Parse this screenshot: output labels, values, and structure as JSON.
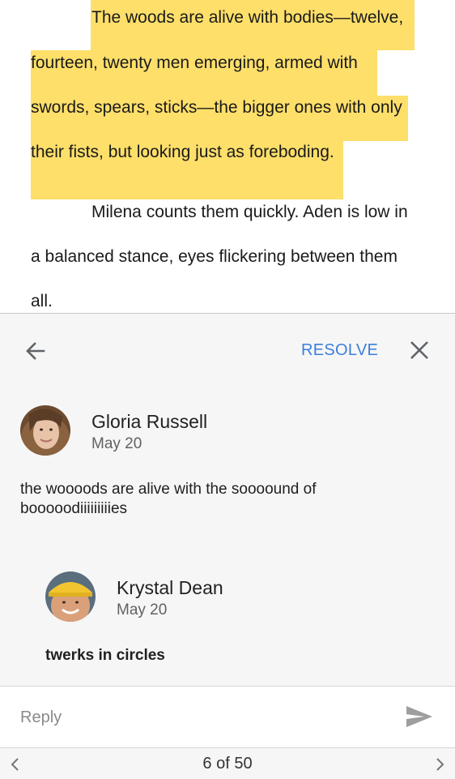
{
  "document": {
    "lines": [
      "The woods are alive with bodies—twelve,",
      "fourteen, twenty men emerging, armed with",
      "swords, spears, sticks—the bigger ones with only",
      "their fists, but looking just as foreboding.",
      "Milena counts them quickly. Aden is low in",
      "a balanced stance, eyes flickering between them",
      "all."
    ],
    "highlight_color": "#fddf6a"
  },
  "comment_panel": {
    "back_icon": "arrow-left-icon",
    "resolve_label": "RESOLVE",
    "close_icon": "close-icon",
    "accent_color": "#3b7fd9",
    "comment": {
      "author": "Gloria Russell",
      "date": "May 20",
      "text": "the woooods are alive with the soooound of booooodiiiiiiiiies"
    },
    "reply": {
      "author": "Krystal Dean",
      "date": "May 20",
      "text": "twerks in circles"
    },
    "reply_box": {
      "placeholder": "Reply",
      "send_icon": "send-icon"
    },
    "pager": {
      "prev_icon": "chevron-left-icon",
      "label": "6 of 50",
      "next_icon": "chevron-right-icon"
    }
  }
}
